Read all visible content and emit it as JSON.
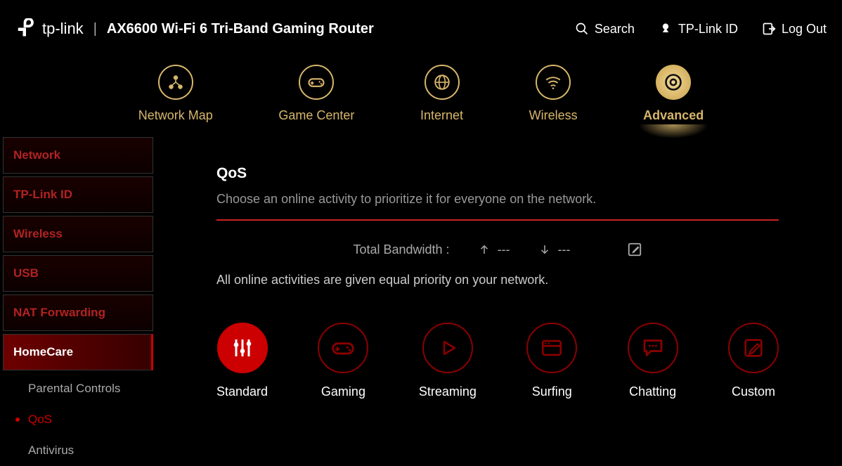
{
  "header": {
    "brand": "tp-link",
    "product": "AX6600 Wi-Fi 6 Tri-Band Gaming Router",
    "search": "Search",
    "account": "TP-Link ID",
    "logout": "Log Out"
  },
  "topnav": [
    {
      "key": "network-map",
      "label": "Network Map",
      "active": false
    },
    {
      "key": "game-center",
      "label": "Game Center",
      "active": false
    },
    {
      "key": "internet",
      "label": "Internet",
      "active": false
    },
    {
      "key": "wireless",
      "label": "Wireless",
      "active": false
    },
    {
      "key": "advanced",
      "label": "Advanced",
      "active": true
    }
  ],
  "sidebar": [
    {
      "key": "network",
      "label": "Network",
      "active": false
    },
    {
      "key": "tplink-id",
      "label": "TP-Link ID",
      "active": false
    },
    {
      "key": "wireless",
      "label": "Wireless",
      "active": false
    },
    {
      "key": "usb",
      "label": "USB",
      "active": false
    },
    {
      "key": "nat",
      "label": "NAT Forwarding",
      "active": false
    },
    {
      "key": "homecare",
      "label": "HomeCare",
      "active": true,
      "children": [
        {
          "key": "parental",
          "label": "Parental Controls",
          "active": false
        },
        {
          "key": "qos",
          "label": "QoS",
          "active": true
        },
        {
          "key": "antivirus",
          "label": "Antivirus",
          "active": false
        }
      ]
    }
  ],
  "main": {
    "title": "QoS",
    "description": "Choose an online activity to prioritize it for everyone on the network.",
    "bandwidth_label": "Total Bandwidth :",
    "upload_value": "---",
    "download_value": "---",
    "priority_text": "All online activities are given equal priority on your network.",
    "qos_modes": [
      {
        "key": "standard",
        "label": "Standard",
        "active": true
      },
      {
        "key": "gaming",
        "label": "Gaming",
        "active": false
      },
      {
        "key": "streaming",
        "label": "Streaming",
        "active": false
      },
      {
        "key": "surfing",
        "label": "Surfing",
        "active": false
      },
      {
        "key": "chatting",
        "label": "Chatting",
        "active": false
      },
      {
        "key": "custom",
        "label": "Custom",
        "active": false
      }
    ]
  }
}
